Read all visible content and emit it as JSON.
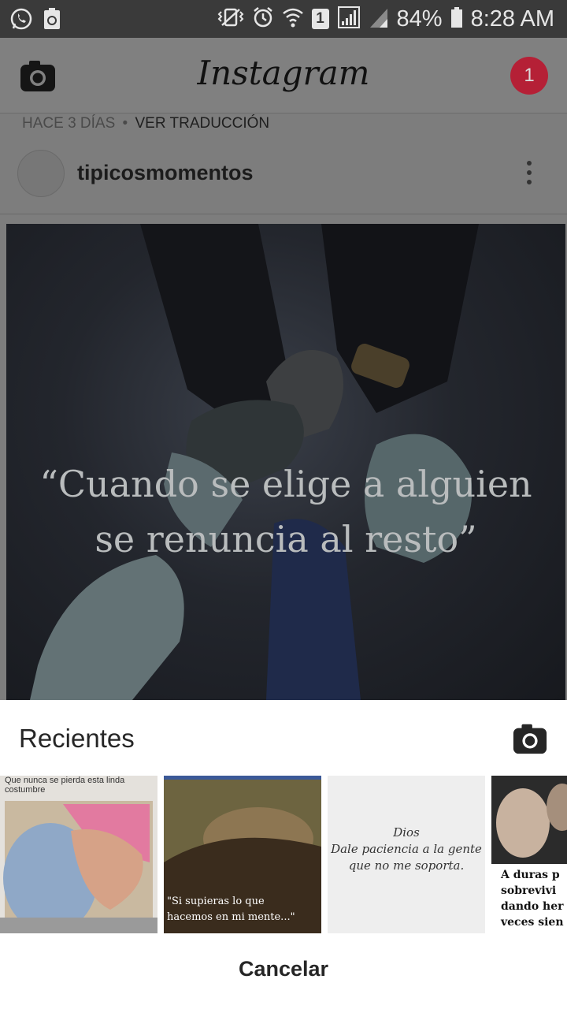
{
  "status_bar": {
    "battery": "84%",
    "time": "8:28 AM",
    "sim": "1",
    "icons": [
      "whatsapp-icon",
      "recycle-icon",
      "vibrate-icon",
      "alarm-icon",
      "wifi-icon",
      "sim-icon",
      "signal-icon",
      "battery-icon"
    ]
  },
  "header": {
    "logo": "Instagram",
    "notification_count": "1"
  },
  "post": {
    "time_ago": "HACE 3 DÍAS",
    "separator": "•",
    "translate": "VER TRADUCCIÓN",
    "username": "tipicosmomentos",
    "quote_line1": "“Cuando se elige a alguien",
    "quote_line2": "se renuncia al resto”"
  },
  "sheet": {
    "title": "Recientes",
    "cancel": "Cancelar",
    "thumbnails": [
      {
        "text": "Que nunca se pierda esta linda costumbre"
      },
      {
        "text_line1": "\"Si supieras lo que",
        "text_line2": "hacemos en mi mente...\""
      },
      {
        "line1": "Dios",
        "line2": "Dale paciencia a la gente",
        "line3": "que no me soporta."
      },
      {
        "line1": "A duras p",
        "line2": "sobrevivi",
        "line3": "dando her",
        "line4": "veces sien"
      }
    ]
  },
  "colors": {
    "notification": "#b52036",
    "overlay_dim": "#7d7d7d"
  }
}
